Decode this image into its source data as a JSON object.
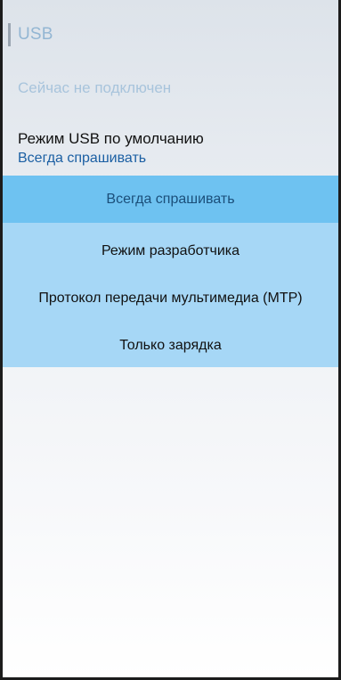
{
  "header": {
    "title": "USB"
  },
  "status_text": "Сейчас не подключен",
  "usb_mode_setting": {
    "label": "Режим USB по умолчанию",
    "value": "Всегда спрашивать"
  },
  "dropdown": {
    "options": [
      {
        "label": "Всегда спрашивать",
        "selected": true
      },
      {
        "label": "Режим разработчика",
        "selected": false
      },
      {
        "label": "Протокол передачи мультимедиа (MTP)",
        "selected": false
      },
      {
        "label": "Только зарядка",
        "selected": false
      }
    ]
  },
  "colors": {
    "accent": "#1b5fa3",
    "dropdown_bg": "#a6d7f6",
    "selected_bg": "#6ec2f1"
  }
}
